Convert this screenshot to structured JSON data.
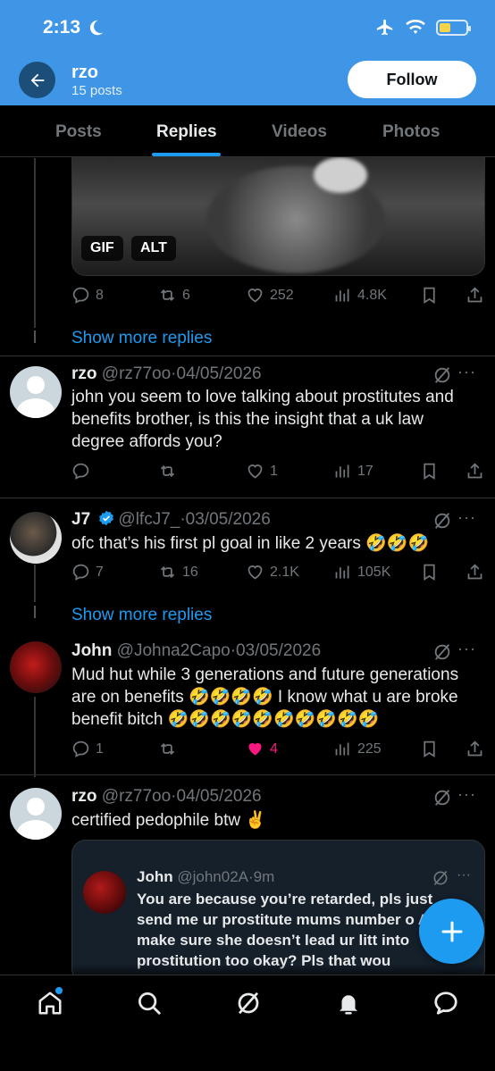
{
  "status_bar": {
    "time": "2:13"
  },
  "header": {
    "name": "rzo",
    "posts_count": "15 posts",
    "follow_label": "Follow"
  },
  "tabs": [
    {
      "label": "Posts"
    },
    {
      "label": "Replies"
    },
    {
      "label": "Videos"
    },
    {
      "label": "Photos"
    }
  ],
  "media": {
    "gif_badge": "GIF",
    "alt_badge": "ALT"
  },
  "post0_actions": {
    "replies": "8",
    "reposts": "6",
    "likes": "252",
    "views": "4.8K"
  },
  "show_more": "Show more replies",
  "posts": [
    {
      "name": "rzo",
      "handle": "@rz77oo",
      "date": "04/05/2026",
      "text": "john you seem to love talking about prostitutes and benefits brother, is this the insight that a uk law degree affords you?",
      "replies": "",
      "reposts": "",
      "likes": "1",
      "views": "17"
    },
    {
      "name": "J7",
      "handle": "@lfcJ7_",
      "date": "03/05/2026",
      "text": "ofc that’s his first pl goal in like 2 years 🤣🤣🤣",
      "replies": "7",
      "reposts": "16",
      "likes": "2.1K",
      "views": "105K"
    },
    {
      "name": "John",
      "handle": "@Johna2Capo",
      "date": "03/05/2026",
      "text": "Mud hut while 3 generations and future generations are on benefits 🤣🤣🤣🤣 I know what u are broke benefit bitch 🤣🤣🤣🤣🤣🤣🤣🤣🤣🤣",
      "replies": "1",
      "reposts": "",
      "likes": "4",
      "views": "225"
    },
    {
      "name": "rzo",
      "handle": "@rz77oo",
      "date": "04/05/2026",
      "text": "certified pedophile btw ✌️"
    }
  ],
  "quote": {
    "name": "John",
    "handle": "@john02A",
    "time": "9m",
    "text": "You are because you’re retarded, pls just send me ur prostitute mums number o And make sure she doesn’t lead ur litt into prostitution too okay? Pls that wou"
  },
  "more_glyph": "···",
  "separator": "·",
  "colors": {
    "accent": "#1d9bf0",
    "like": "#f91880",
    "header_bg": "#3f96e6"
  }
}
